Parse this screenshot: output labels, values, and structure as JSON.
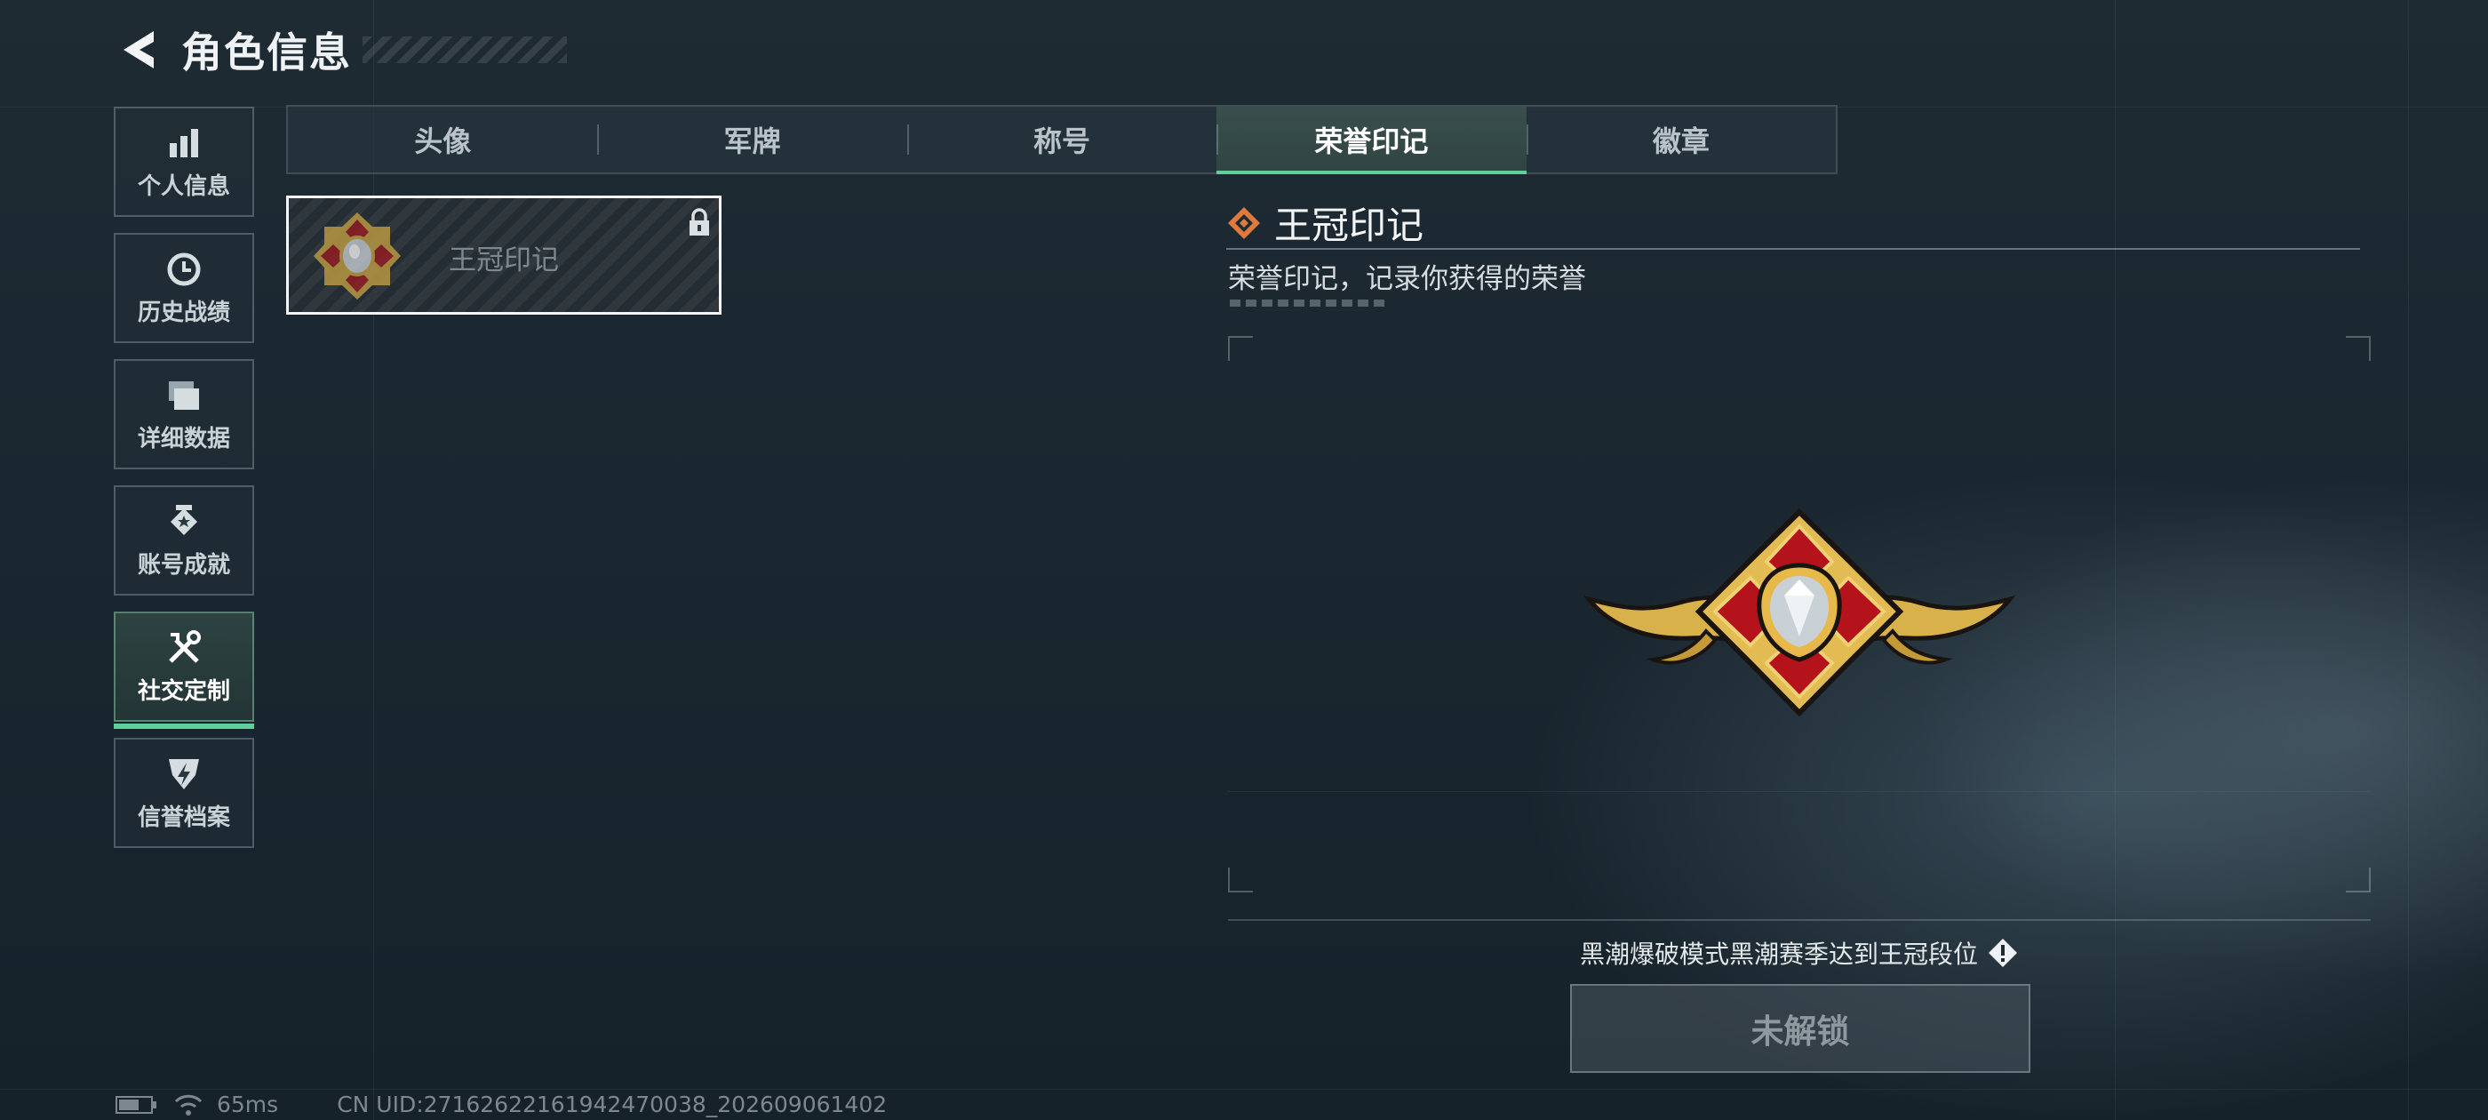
{
  "header": {
    "title": "角色信息"
  },
  "sidebar": {
    "items": [
      {
        "label": "个人信息",
        "icon": "bar-chart-icon",
        "active": false
      },
      {
        "label": "历史战绩",
        "icon": "history-icon",
        "active": false
      },
      {
        "label": "详细数据",
        "icon": "folder-icon",
        "active": false
      },
      {
        "label": "账号成就",
        "icon": "achievement-icon",
        "active": false
      },
      {
        "label": "社交定制",
        "icon": "tools-icon",
        "active": true
      },
      {
        "label": "信誉档案",
        "icon": "shield-icon",
        "active": false
      }
    ]
  },
  "tabs": [
    {
      "label": "头像",
      "active": false
    },
    {
      "label": "军牌",
      "active": false
    },
    {
      "label": "称号",
      "active": false
    },
    {
      "label": "荣誉印记",
      "active": true
    },
    {
      "label": "徽章",
      "active": false
    }
  ],
  "items": [
    {
      "name": "王冠印记",
      "locked": true,
      "icon": "crown-emblem-icon"
    }
  ],
  "detail": {
    "title": "王冠印记",
    "description": "荣誉印记，记录你获得的荣誉",
    "condition": "黑潮爆破模式黑潮赛季达到王冠段位",
    "button_label": "未解锁"
  },
  "status": {
    "ping": "65ms",
    "uid": "CN UID:27162622161942470038_202609061402"
  },
  "colors": {
    "accent": "#5fd09a",
    "emblem_gold": "#d8b14a",
    "emblem_red": "#b5131b",
    "diamond_orange": "#e07a3c"
  }
}
